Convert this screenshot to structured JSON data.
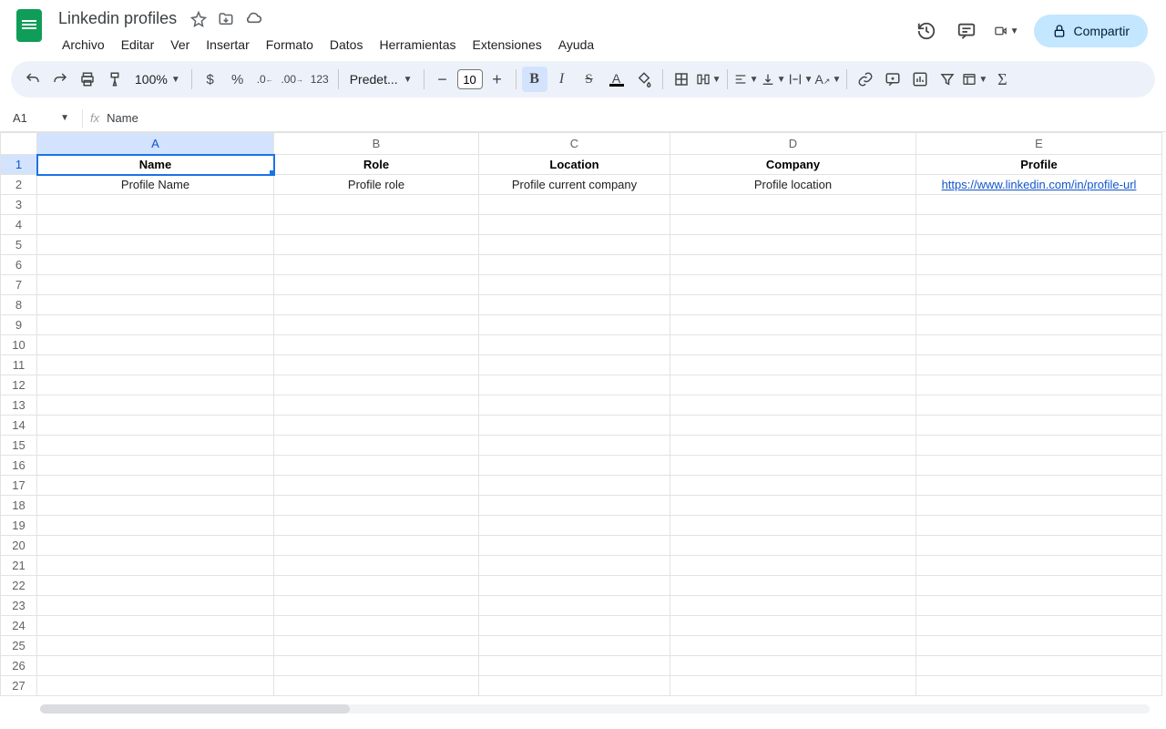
{
  "doc": {
    "title": "Linkedin profiles"
  },
  "menubar": [
    "Archivo",
    "Editar",
    "Ver",
    "Insertar",
    "Formato",
    "Datos",
    "Herramientas",
    "Extensiones",
    "Ayuda"
  ],
  "share_label": "Compartir",
  "toolbar": {
    "zoom": "100%",
    "font": "Predet...",
    "font_size": "10"
  },
  "namebox": {
    "ref": "A1",
    "formula": "Name"
  },
  "columns": [
    "A",
    "B",
    "C",
    "D",
    "E"
  ],
  "rows": [
    {
      "n": "1",
      "cells": [
        "Name",
        "Role",
        "Location",
        "Company",
        "Profile"
      ],
      "bold": true
    },
    {
      "n": "2",
      "cells": [
        "Profile Name",
        "Profile role",
        "Profile current company",
        "Profile location",
        "https://www.linkedin.com/in/profile-url"
      ],
      "link_col": 4
    }
  ],
  "selected": {
    "col": 0,
    "row": 0
  },
  "empty_rows": 25
}
